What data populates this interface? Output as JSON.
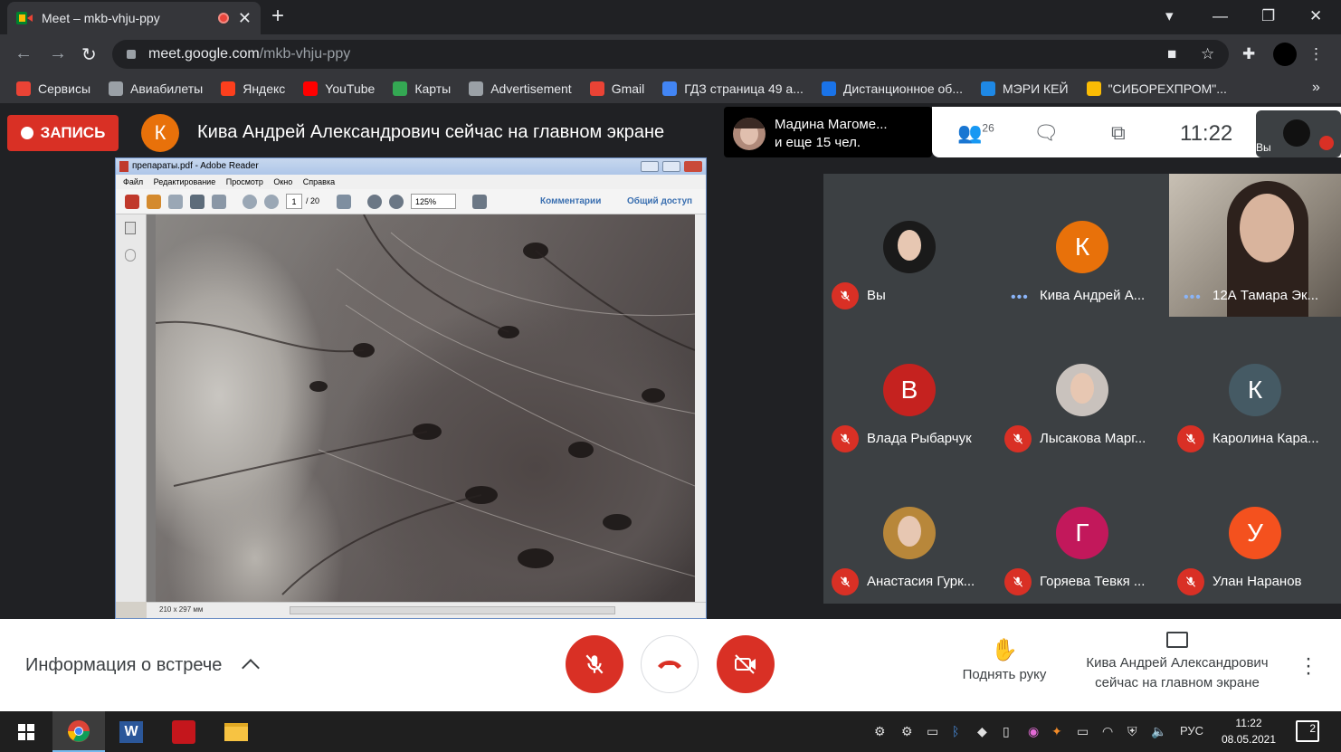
{
  "browser": {
    "tab_title": "Meet – mkb-vhju-ppy",
    "url_host": "meet.google.com",
    "url_path": "/mkb-vhju-ppy",
    "bookmarks": [
      {
        "label": "Сервисы",
        "icon": "apps-grid-icon",
        "color": "#ea4335"
      },
      {
        "label": "Авиабилеты",
        "icon": "globe-icon",
        "color": "#9aa0a6"
      },
      {
        "label": "Яндекс",
        "icon": "yandex-icon",
        "color": "#fc3f1d"
      },
      {
        "label": "YouTube",
        "icon": "youtube-icon",
        "color": "#ff0000"
      },
      {
        "label": "Карты",
        "icon": "maps-icon",
        "color": "#34a853"
      },
      {
        "label": "Advertisement",
        "icon": "globe-icon",
        "color": "#9aa0a6"
      },
      {
        "label": "Gmail",
        "icon": "gmail-icon",
        "color": "#ea4335"
      },
      {
        "label": "ГДЗ страница 49 а...",
        "icon": "gdz-icon",
        "color": "#4285f4"
      },
      {
        "label": "Дистанционное об...",
        "icon": "bookmark-site-icon",
        "color": "#1a73e8"
      },
      {
        "label": "МЭРИ КЕЙ",
        "icon": "cloud-icon",
        "color": "#1e88e5"
      },
      {
        "label": "\"СИБОРЕХПРОМ\"...",
        "icon": "sibor-icon",
        "color": "#fbbc04"
      }
    ],
    "bookmarks_more": "»"
  },
  "meet": {
    "record_label": "ЗАПИСЬ",
    "presenter_initial": "К",
    "presenter_text": "Кива Андрей Александрович сейчас на главном экране",
    "viewers_line1": "Мадина Магоме...",
    "viewers_line2": "и еще 15 чел.",
    "people_count": "26",
    "clock": "11:22",
    "self_label": "Вы",
    "accent_red": "#d93025"
  },
  "shared_screen": {
    "window_title": "препараты.pdf - Adobe Reader",
    "menu": [
      "Файл",
      "Редактирование",
      "Просмотр",
      "Окно",
      "Справка"
    ],
    "page_current": "1",
    "page_total": "/ 20",
    "zoom": "125%",
    "comments_link": "Комментарии",
    "share_link": "Общий доступ",
    "page_size": "210 x 297 мм"
  },
  "participants": [
    {
      "name": "Вы",
      "initial": "",
      "color": "#1a1a1a",
      "muted": true,
      "speaking": false,
      "photo": true
    },
    {
      "name": "Кива Андрей А...",
      "initial": "К",
      "color": "#e8710a",
      "muted": false,
      "speaking": true,
      "photo": false
    },
    {
      "name": "12А Тамара Эк...",
      "initial": "",
      "color": "#9a8f86",
      "muted": false,
      "speaking": true,
      "photo": true
    },
    {
      "name": "Влада Рыбарчук",
      "initial": "В",
      "color": "#c5221f",
      "muted": true,
      "speaking": false,
      "photo": false
    },
    {
      "name": "Лысакова Марг...",
      "initial": "",
      "color": "#c9c2bd",
      "muted": true,
      "speaking": false,
      "photo": true
    },
    {
      "name": "Каролина Кара...",
      "initial": "К",
      "color": "#455a64",
      "muted": true,
      "speaking": false,
      "photo": false
    },
    {
      "name": "Анастасия Гурк...",
      "initial": "",
      "color": "#b8873a",
      "muted": true,
      "speaking": false,
      "photo": true
    },
    {
      "name": "Горяева Тевкя ...",
      "initial": "Г",
      "color": "#c2185b",
      "muted": true,
      "speaking": false,
      "photo": false
    },
    {
      "name": "Улан Наранов",
      "initial": "У",
      "color": "#f4511e",
      "muted": true,
      "speaking": false,
      "photo": false
    }
  ],
  "controls": {
    "meeting_info": "Информация о встрече",
    "raise_hand": "Поднять руку",
    "presenting_line1": "Кива Андрей Александрович",
    "presenting_line2": "сейчас на главном экране"
  },
  "taskbar": {
    "lang": "РУС",
    "time": "11:22",
    "date": "08.05.2021",
    "notifications": "2"
  }
}
